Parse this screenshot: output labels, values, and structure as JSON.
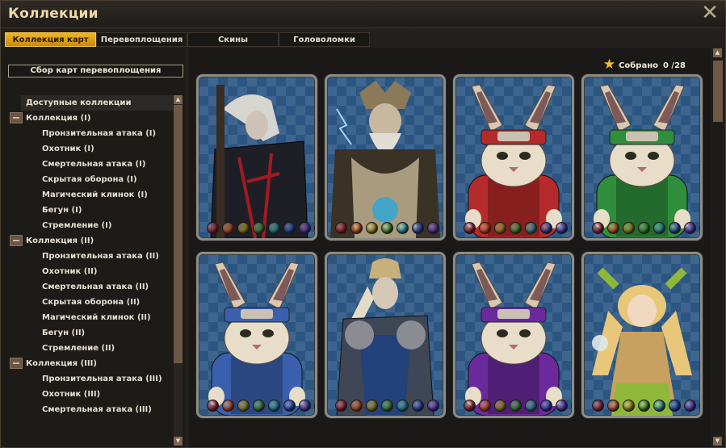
{
  "window": {
    "title": "Коллекции",
    "close_icon": "close-icon"
  },
  "tabs": [
    "Коллекция карт",
    "Перевоплощения",
    "Скины",
    "Головоломки"
  ],
  "left": {
    "button_label": "Сбор карт перевоплощения",
    "tree": [
      {
        "type": "header",
        "label": "Доступные коллекции"
      },
      {
        "type": "group",
        "label": "Коллекция (I)"
      },
      {
        "type": "item",
        "label": "Пронзительная атака (I)"
      },
      {
        "type": "item",
        "label": "Охотник (I)"
      },
      {
        "type": "item",
        "label": "Смертельная атака (I)"
      },
      {
        "type": "item",
        "label": "Скрытая оборона (I)"
      },
      {
        "type": "item",
        "label": "Магический клинок (I)"
      },
      {
        "type": "item",
        "label": "Бегун (I)"
      },
      {
        "type": "item",
        "label": "Стремление (I)"
      },
      {
        "type": "group",
        "label": "Коллекция (II)"
      },
      {
        "type": "item",
        "label": "Пронзительная атака (II)"
      },
      {
        "type": "item",
        "label": "Охотник (II)"
      },
      {
        "type": "item",
        "label": "Смертельная атака (II)"
      },
      {
        "type": "item",
        "label": "Скрытая оборона (II)"
      },
      {
        "type": "item",
        "label": "Магический клинок (II)"
      },
      {
        "type": "item",
        "label": "Бегун (II)"
      },
      {
        "type": "item",
        "label": "Стремление (II)"
      },
      {
        "type": "group",
        "label": "Коллекция (III)"
      },
      {
        "type": "item",
        "label": "Пронзительная атака (III)"
      },
      {
        "type": "item",
        "label": "Охотник (III)"
      },
      {
        "type": "item",
        "label": "Смертельная атака (III)"
      }
    ]
  },
  "collected": {
    "label": "Собрано",
    "value": "0 /28",
    "icon": "star-icon"
  },
  "gem_colors": [
    "#8e1b2a",
    "#b0461a",
    "#8d7a12",
    "#2f7a2b",
    "#1d7f86",
    "#233e9a",
    "#4c2b96",
    "#7b2a8b"
  ],
  "cards": [
    {
      "name": "dark-knight",
      "theme": "#1f2430",
      "accent": "#a41920"
    },
    {
      "name": "lightning-king",
      "theme": "#3b3226",
      "accent": "#d8c9a4"
    },
    {
      "name": "red-rabbit",
      "theme": "#2b2b2c",
      "accent": "#b52a2a"
    },
    {
      "name": "green-rabbit",
      "theme": "#2b2b2c",
      "accent": "#2f8e3c"
    },
    {
      "name": "blue-rabbit",
      "theme": "#2b2b2c",
      "accent": "#3a5fae"
    },
    {
      "name": "armored-knight",
      "theme": "#2d3340",
      "accent": "#c7b07a"
    },
    {
      "name": "purple-rabbit",
      "theme": "#2b2b2c",
      "accent": "#6a2a9c"
    },
    {
      "name": "forest-girl",
      "theme": "#3a3320",
      "accent": "#8fb83a"
    }
  ]
}
